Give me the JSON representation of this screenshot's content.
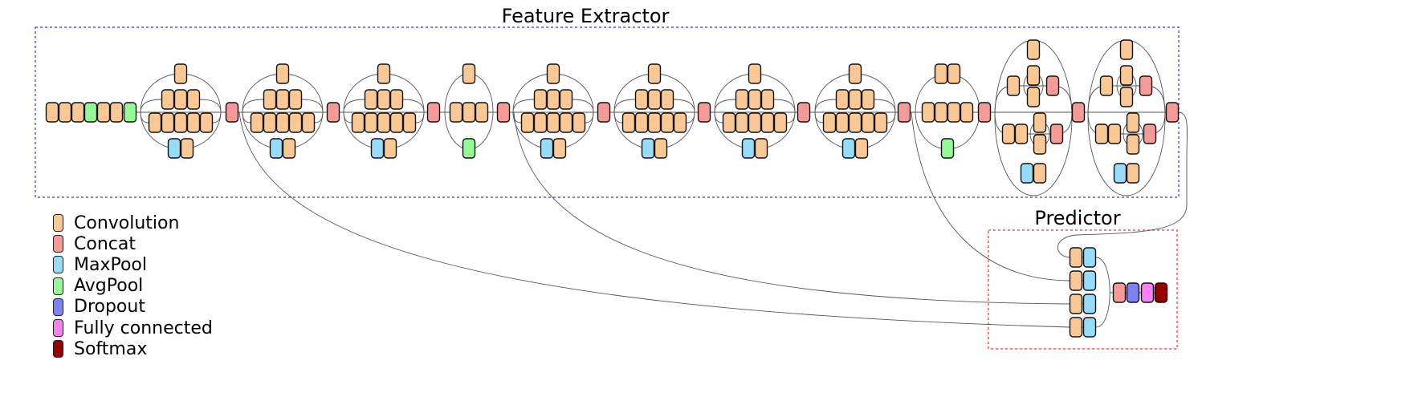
{
  "colors": {
    "conv": "#f8c896",
    "concat": "#f59a96",
    "maxpool": "#96dcf8",
    "avgpool": "#96f896",
    "dropout": "#8080f8",
    "fc": "#f880f0",
    "softmax": "#960000",
    "feature_box": "#3333ff",
    "predictor_box": "#ff5555"
  },
  "feature_extractor": {
    "title": "Feature Extractor",
    "stem": [
      "conv",
      "conv",
      "conv",
      "avgpool",
      "conv",
      "conv",
      "avgpool"
    ],
    "modules": [
      "A",
      "A",
      "A",
      "B",
      "A",
      "A",
      "A",
      "A",
      "D",
      "C",
      "C"
    ]
  },
  "predictor": {
    "title": "Predictor",
    "branches": [
      [
        "conv",
        "maxpool"
      ],
      [
        "conv",
        "maxpool"
      ],
      [
        "conv",
        "maxpool"
      ],
      [
        "conv",
        "maxpool"
      ]
    ],
    "head": [
      "concat",
      "dropout",
      "fc",
      "softmax"
    ]
  },
  "legend": [
    {
      "type": "conv",
      "label": "Convolution"
    },
    {
      "type": "concat",
      "label": "Concat"
    },
    {
      "type": "maxpool",
      "label": "MaxPool"
    },
    {
      "type": "avgpool",
      "label": "AvgPool"
    },
    {
      "type": "dropout",
      "label": "Dropout"
    },
    {
      "type": "fc",
      "label": "Fully connected"
    },
    {
      "type": "softmax",
      "label": "Softmax"
    }
  ]
}
